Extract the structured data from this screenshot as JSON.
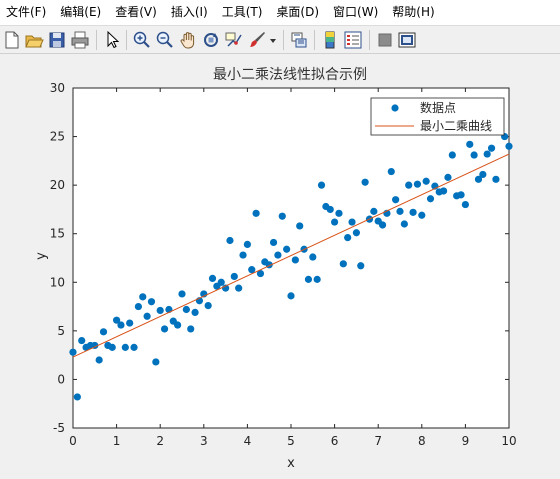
{
  "menu": [
    "文件(F)",
    "编辑(E)",
    "查看(V)",
    "插入(I)",
    "工具(T)",
    "桌面(D)",
    "窗口(W)",
    "帮助(H)"
  ],
  "toolbar_icons": [
    "new-figure-icon",
    "open-file-icon",
    "save-icon",
    "print-icon",
    "pointer-icon",
    "zoom-in-icon",
    "zoom-out-icon",
    "pan-icon",
    "rotate-3d-icon",
    "data-cursor-icon",
    "brush-icon",
    "brush-dropdown-icon",
    "link-plot-icon",
    "colorbar-icon",
    "legend-icon",
    "hide-plot-tools-icon",
    "show-plot-tools-icon"
  ],
  "chart_data": {
    "type": "scatter",
    "title": "最小二乘法线性拟合示例",
    "xlabel": "x",
    "ylabel": "y",
    "xlim": [
      0,
      10
    ],
    "ylim": [
      -5,
      30
    ],
    "xticks": [
      "0",
      "1",
      "2",
      "3",
      "4",
      "5",
      "6",
      "7",
      "8",
      "9",
      "10"
    ],
    "yticks": [
      "-5",
      "0",
      "5",
      "10",
      "15",
      "20",
      "25",
      "30"
    ],
    "grid": false,
    "legend_position": "top-right",
    "series": [
      {
        "name": "数据点",
        "type": "scatter",
        "color": "#0072bd",
        "x": [
          0.0,
          0.1,
          0.2,
          0.3,
          0.4,
          0.5,
          0.6,
          0.7,
          0.8,
          0.9,
          1.0,
          1.1,
          1.2,
          1.3,
          1.4,
          1.5,
          1.6,
          1.7,
          1.8,
          1.9,
          2.0,
          2.1,
          2.2,
          2.3,
          2.4,
          2.5,
          2.6,
          2.7,
          2.8,
          2.9,
          3.0,
          3.1,
          3.2,
          3.3,
          3.4,
          3.5,
          3.6,
          3.7,
          3.8,
          3.9,
          4.0,
          4.1,
          4.2,
          4.3,
          4.4,
          4.5,
          4.6,
          4.7,
          4.8,
          4.9,
          5.0,
          5.1,
          5.2,
          5.3,
          5.4,
          5.5,
          5.6,
          5.7,
          5.8,
          5.9,
          6.0,
          6.1,
          6.2,
          6.3,
          6.4,
          6.5,
          6.6,
          6.7,
          6.8,
          6.9,
          7.0,
          7.1,
          7.2,
          7.3,
          7.4,
          7.5,
          7.6,
          7.7,
          7.8,
          7.9,
          8.0,
          8.1,
          8.2,
          8.3,
          8.4,
          8.5,
          8.6,
          8.7,
          8.8,
          8.9,
          9.0,
          9.1,
          9.2,
          9.3,
          9.4,
          9.5,
          9.6,
          9.7,
          9.8,
          9.9,
          10.0
        ],
        "y": [
          2.8,
          -1.8,
          4.0,
          3.3,
          3.5,
          3.5,
          2.0,
          4.9,
          3.5,
          3.3,
          6.1,
          5.6,
          3.3,
          5.8,
          3.3,
          7.5,
          8.5,
          6.5,
          8.0,
          1.8,
          7.1,
          5.2,
          7.2,
          6.0,
          5.6,
          8.8,
          7.2,
          5.2,
          6.9,
          8.1,
          8.8,
          7.6,
          10.4,
          9.6,
          10.0,
          9.4,
          14.3,
          10.6,
          9.4,
          12.8,
          13.9,
          11.3,
          17.1,
          10.9,
          12.1,
          11.8,
          14.1,
          12.8,
          16.8,
          13.4,
          8.6,
          12.3,
          15.8,
          13.4,
          10.3,
          12.6,
          10.3,
          20.0,
          17.8,
          17.5,
          16.2,
          17.1,
          11.9,
          14.6,
          16.2,
          15.1,
          11.7,
          20.3,
          16.5,
          17.3,
          16.3,
          15.9,
          17.1,
          21.4,
          18.5,
          17.3,
          16.0,
          20.0,
          17.2,
          20.1,
          16.9,
          20.4,
          18.6,
          19.9,
          19.3,
          19.4,
          20.8,
          23.1,
          18.9,
          19.0,
          18.0,
          24.2,
          23.1,
          20.6,
          21.1,
          23.2,
          23.8,
          20.6,
          27.4,
          25.0,
          24.0
        ]
      },
      {
        "name": "最小二乘曲线",
        "type": "line",
        "color": "#d95319",
        "x": [
          0,
          10
        ],
        "y": [
          2.3,
          23.2
        ]
      }
    ]
  }
}
